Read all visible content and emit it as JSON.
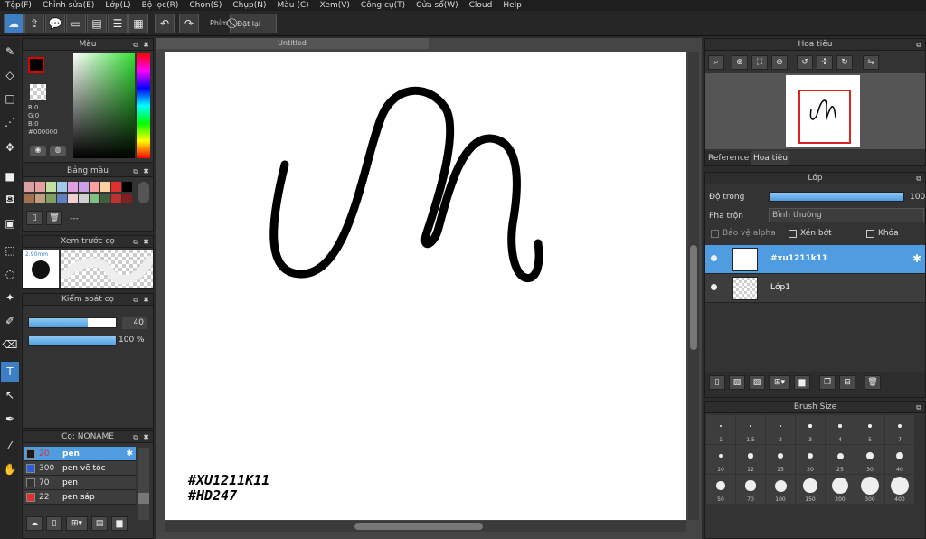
{
  "menu": [
    "Tệp(F)",
    "Chỉnh sửa(E)",
    "Lớp(L)",
    "Bộ lọc(R)",
    "Chọn(S)",
    "Chụp(N)",
    "Màu (C)",
    "Xem(V)",
    "Công cụ(T)",
    "Cửa sổ(W)",
    "Cloud",
    "Help"
  ],
  "toolbar": {
    "key_label": "Phím",
    "reset_label": "Đặt lại"
  },
  "color_panel": {
    "title": "Màu",
    "r": "R:0",
    "g": "G:0",
    "b": "B:0",
    "hex": "#000000"
  },
  "palette_panel": {
    "title": "Bảng màu",
    "dash": "---",
    "swatches": [
      "#d9a0a0",
      "#e8a0a0",
      "#c0e0a0",
      "#a0c8e8",
      "#e0a0e0",
      "#c8a0e8",
      "#ffa0a0",
      "#ffd0a0",
      "#e03030",
      "#000000",
      "#a07050",
      "#c0a080",
      "#80a060",
      "#6080c0",
      "#f0d0d0",
      "#d0d0d0",
      "#80c080",
      "#406040",
      "#c03030",
      "#802020"
    ]
  },
  "preview_panel": {
    "title": "Xem trước cọ",
    "size": "2.90mm"
  },
  "brush_control": {
    "title": "Kiểm soát cọ",
    "size_value": "40",
    "size_fraction": 0.68,
    "opacity_value": "100 %",
    "opacity_fraction": 1.0
  },
  "brush_list": {
    "title": "Cọ: NONAME",
    "items": [
      {
        "size": "20",
        "name": "pen",
        "color": "#1a1a1a",
        "selected": true
      },
      {
        "size": "300",
        "name": "pen vẽ tóc",
        "color": "#2b5fd6",
        "selected": false
      },
      {
        "size": "70",
        "name": "pen",
        "color": "#333333",
        "selected": false
      },
      {
        "size": "22",
        "name": "pen sáp",
        "color": "#e03030",
        "selected": false
      }
    ]
  },
  "canvas": {
    "tab_title": "Untitled",
    "text_line1": "#XU1211K11",
    "text_line2": "#HD247"
  },
  "navigator": {
    "title": "Hoa tiêu",
    "tab_reference": "Reference",
    "tab_navigator": "Hoa tiêu"
  },
  "layer_panel": {
    "title": "Lớp",
    "opacity_label": "Độ trong",
    "opacity_value": "100",
    "blend_label": "Pha trộn",
    "blend_value": "Bình thường",
    "protect_alpha": "Bảo vệ alpha",
    "clipping": "Xén bớt",
    "lock": "Khóa",
    "layers": [
      {
        "name": "#xu1211k11",
        "selected": true
      },
      {
        "name": "Lớp1",
        "selected": false
      }
    ]
  },
  "brush_size_panel": {
    "title": "Brush Size",
    "sizes": [
      "1",
      "1.5",
      "2",
      "3",
      "4",
      "5",
      "7",
      "10",
      "12",
      "15",
      "20",
      "25",
      "30",
      "40",
      "50",
      "70",
      "100",
      "150",
      "200",
      "300",
      "400"
    ]
  }
}
